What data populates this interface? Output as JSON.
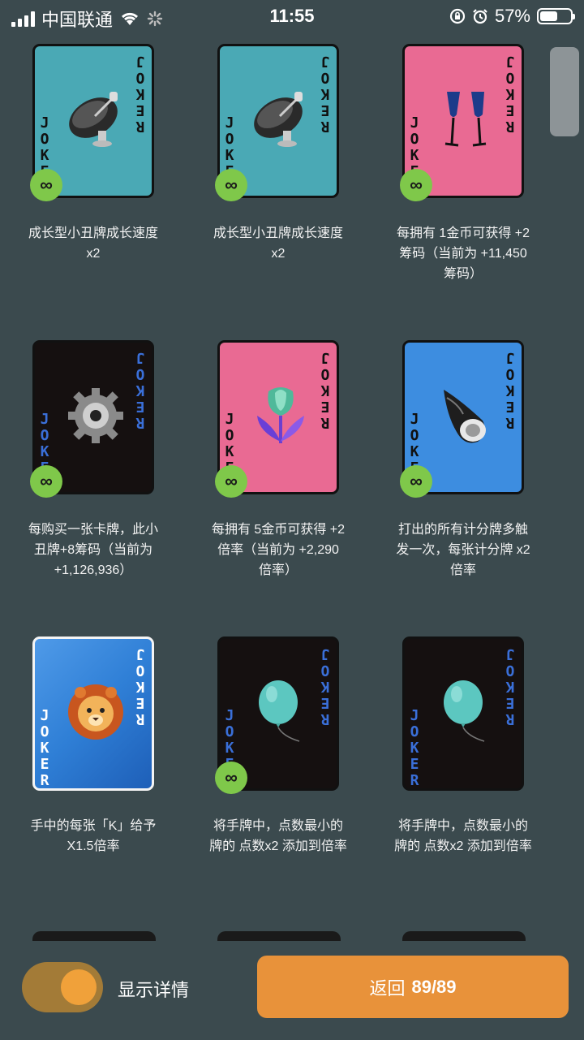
{
  "status": {
    "carrier": "中国联通",
    "time": "11:55",
    "battery": "57%",
    "battery_level": 0.57
  },
  "jokers": [
    {
      "art": "satellite-dish",
      "color": "#4aa9b5",
      "label_color": "#111111",
      "infinite": true,
      "desc_lines": [
        "成长型小丑牌成长速度",
        "x2"
      ]
    },
    {
      "art": "satellite-dish",
      "color": "#4aa9b5",
      "label_color": "#111111",
      "infinite": true,
      "desc_lines": [
        "成长型小丑牌成长速度",
        "x2"
      ]
    },
    {
      "art": "champagne-glasses",
      "color": "#e96a93",
      "label_color": "#111111",
      "infinite": true,
      "desc_lines": [
        "每拥有 1金币可获得 +2",
        "筹码（当前为 +11,450",
        "筹码）"
      ]
    },
    {
      "art": "gear",
      "color": "#151010",
      "label_color": "#3a6fd8",
      "infinite": true,
      "desc_lines": [
        "每购买一张卡牌，此小",
        "丑牌+8筹码（当前为",
        "+1,126,936）"
      ]
    },
    {
      "art": "tulip",
      "color": "#e96a93",
      "label_color": "#111111",
      "infinite": true,
      "desc_lines": [
        "每拥有 5金币可获得 +2",
        "倍率（当前为 +2,290",
        "倍率）"
      ]
    },
    {
      "art": "shell",
      "color": "#3d8de0",
      "label_color": "#111111",
      "infinite": true,
      "desc_lines": [
        "打出的所有计分牌多触",
        "发一次，每张计分牌 x2",
        "倍率"
      ]
    },
    {
      "art": "lion",
      "color": "#2f7fd6",
      "label_color": "#ffffff",
      "infinite": false,
      "desc_lines": [
        "手中的每张「K」给予",
        "X1.5倍率"
      ]
    },
    {
      "art": "balloon",
      "color": "#151010",
      "label_color": "#3a6fd8",
      "infinite": true,
      "desc_lines": [
        "将手牌中，点数最小的",
        "牌的 点数x2 添加到倍率"
      ]
    },
    {
      "art": "balloon",
      "color": "#151010",
      "label_color": "#3a6fd8",
      "infinite": false,
      "desc_lines": [
        "将手牌中，点数最小的",
        "牌的 点数x2 添加到倍率"
      ]
    }
  ],
  "card_label": "JOKER",
  "infinity_symbol": "∞",
  "footer": {
    "toggle_label": "显示详情",
    "toggle_on": true,
    "back_label": "返回",
    "back_count": "89/89"
  }
}
